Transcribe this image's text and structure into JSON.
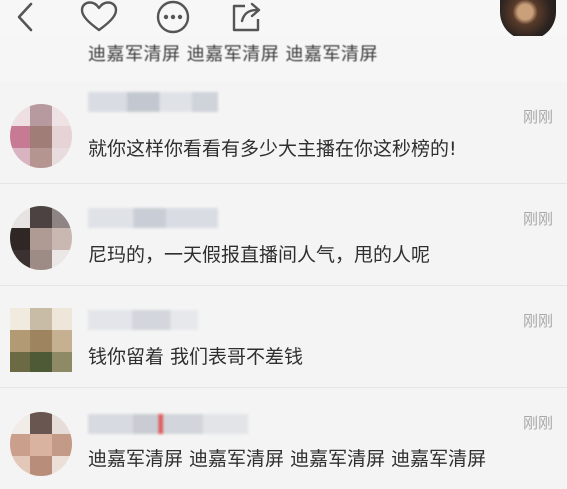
{
  "toolbar": {
    "icons": [
      "back-icon",
      "heart-icon",
      "more-icon",
      "share-icon"
    ]
  },
  "top_strip": {
    "text": "迪嘉军清屏 迪嘉军清屏 迪嘉军清屏"
  },
  "comments": [
    {
      "time": "刚刚",
      "text": "就你这样你看看有多少大主播在你这秒榜的!"
    },
    {
      "time": "刚刚",
      "text": "尼玛的，一天假报直播间人气，甩的人呢"
    },
    {
      "time": "刚刚",
      "text": "钱你留着 我们表哥不差钱"
    },
    {
      "time": "刚刚",
      "text": "迪嘉军清屏 迪嘉军清屏 迪嘉军清屏 迪嘉军清屏"
    }
  ],
  "colors": {
    "background": "#f4f4f4",
    "text": "#2f2f2f",
    "time": "#a8a8a8"
  }
}
